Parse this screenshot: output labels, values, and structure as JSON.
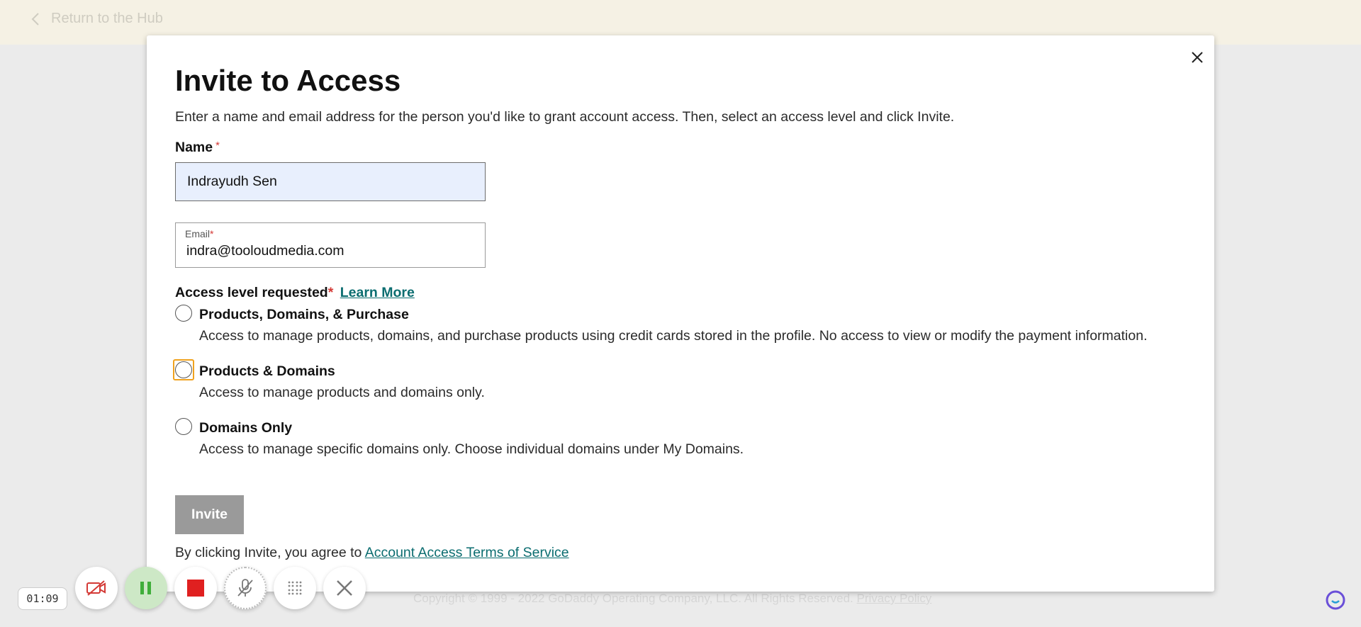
{
  "topbar": {
    "back_label": "Return to the Hub"
  },
  "footer": {
    "copyright": "Copyright © 1999 - 2022 GoDaddy Operating Company, LLC. All Rights Reserved.",
    "privacy_link": "Privacy Policy"
  },
  "modal": {
    "title": "Invite to Access",
    "intro": "Enter a name and email address for the person you'd like to grant account access. Then, select an access level and click Invite.",
    "name_label": "Name",
    "name_value": "Indrayudh Sen",
    "email_label": "Email",
    "email_value": "indra@tooloudmedia.com",
    "required_mark": "*",
    "access_label": "Access level requested",
    "learn_more": "Learn More",
    "options": [
      {
        "title": "Products, Domains, & Purchase",
        "desc": "Access to manage products, domains, and purchase products using credit cards stored in the profile. No access to view or modify the payment information."
      },
      {
        "title": "Products & Domains",
        "desc": "Access to manage products and domains only."
      },
      {
        "title": "Domains Only",
        "desc": "Access to manage specific domains only. Choose individual domains under My Domains."
      }
    ],
    "invite_button": "Invite",
    "terms_prefix": "By clicking Invite, you agree to",
    "terms_link": "Account Access Terms of Service"
  },
  "recorder": {
    "timer": "01:09"
  },
  "colors": {
    "accent_link": "#0b6d70",
    "required": "#d43a36",
    "topbar_bg": "#f5f1e4",
    "focus": "#f0a21e",
    "invite_disabled": "#9a9a9a"
  }
}
